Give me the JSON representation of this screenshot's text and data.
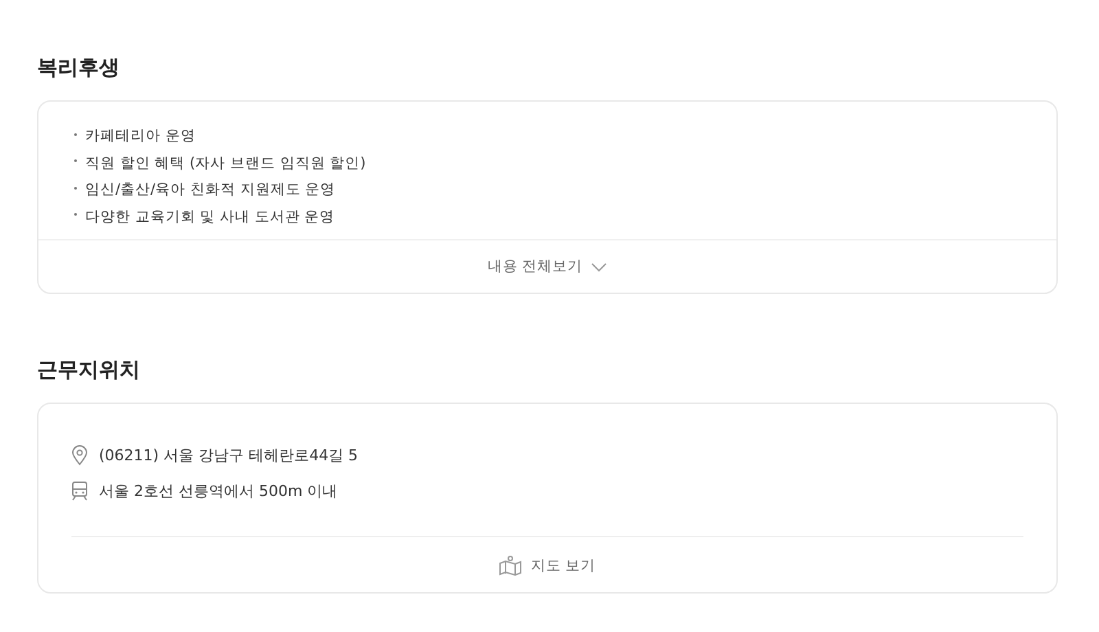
{
  "sections": [
    {
      "title": "복리후생",
      "kind": "list",
      "items": [
        "카페테리아 운영",
        "직원 할인 혜택 (자사 브랜드 임직원 할인)",
        "임신/출산/육아 친화적 지원제도 운영",
        "다양한 교육기회 및 사내 도서관 운영"
      ],
      "more_button": "내용 전체보기"
    },
    {
      "title": "근무지위치",
      "kind": "location",
      "address": "(06211) 서울 강남구 테헤란로44길 5",
      "transit": "서울 2호선 선릉역에서 500m 이내",
      "map_button": "지도 보기"
    }
  ]
}
